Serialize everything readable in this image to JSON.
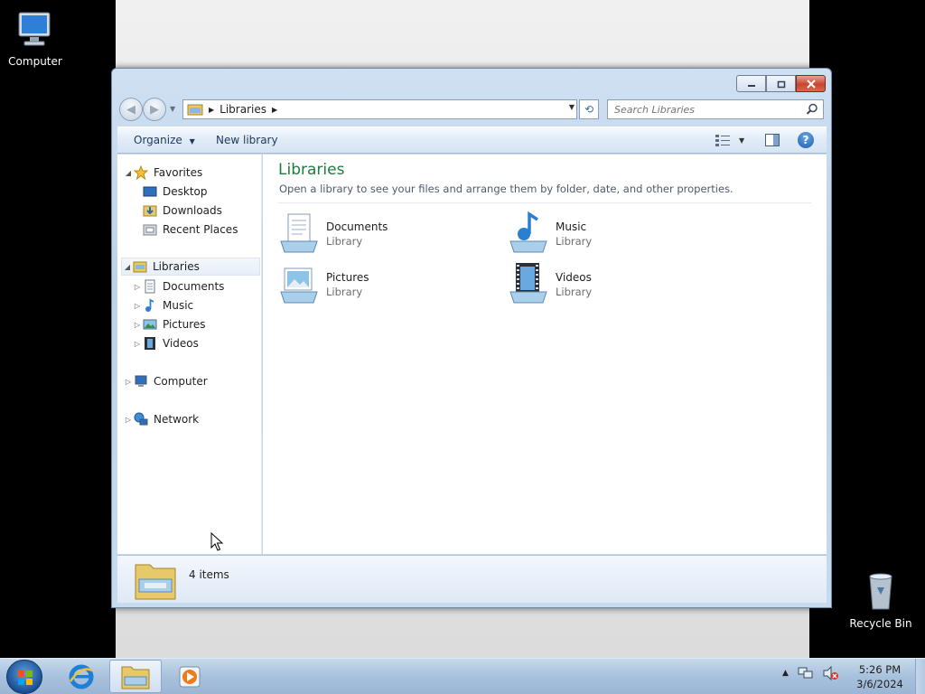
{
  "desktop": {
    "icons": [
      {
        "label": "Computer",
        "icon": "computer-icon"
      },
      {
        "label": "Recycle Bin",
        "icon": "recycle-bin-icon"
      }
    ]
  },
  "window": {
    "caption_buttons": {
      "minimize": "minimize",
      "maximize": "maximize",
      "close": "close"
    },
    "address": {
      "path": [
        "Libraries"
      ]
    },
    "search": {
      "placeholder": "Search Libraries"
    },
    "toolbar": {
      "organize": "Organize",
      "new_library": "New library"
    },
    "nav": {
      "favorites": {
        "label": "Favorites",
        "items": [
          "Desktop",
          "Downloads",
          "Recent Places"
        ]
      },
      "libraries": {
        "label": "Libraries",
        "items": [
          "Documents",
          "Music",
          "Pictures",
          "Videos"
        ]
      },
      "computer": "Computer",
      "network": "Network"
    },
    "content": {
      "title": "Libraries",
      "subtitle": "Open a library to see your files and arrange them by folder, date, and other properties.",
      "items": [
        {
          "name": "Documents",
          "type": "Library",
          "icon": "documents-library-icon"
        },
        {
          "name": "Music",
          "type": "Library",
          "icon": "music-library-icon"
        },
        {
          "name": "Pictures",
          "type": "Library",
          "icon": "pictures-library-icon"
        },
        {
          "name": "Videos",
          "type": "Library",
          "icon": "videos-library-icon"
        }
      ]
    },
    "details": {
      "count": "4 items"
    }
  },
  "taskbar": {
    "apps": [
      "internet-explorer-icon",
      "windows-explorer-icon",
      "media-player-icon"
    ],
    "clock": {
      "time": "5:26 PM",
      "date": "3/6/2024"
    }
  },
  "colors": {
    "title_green": "#1e7c3e",
    "link_blue": "#1e395b"
  }
}
